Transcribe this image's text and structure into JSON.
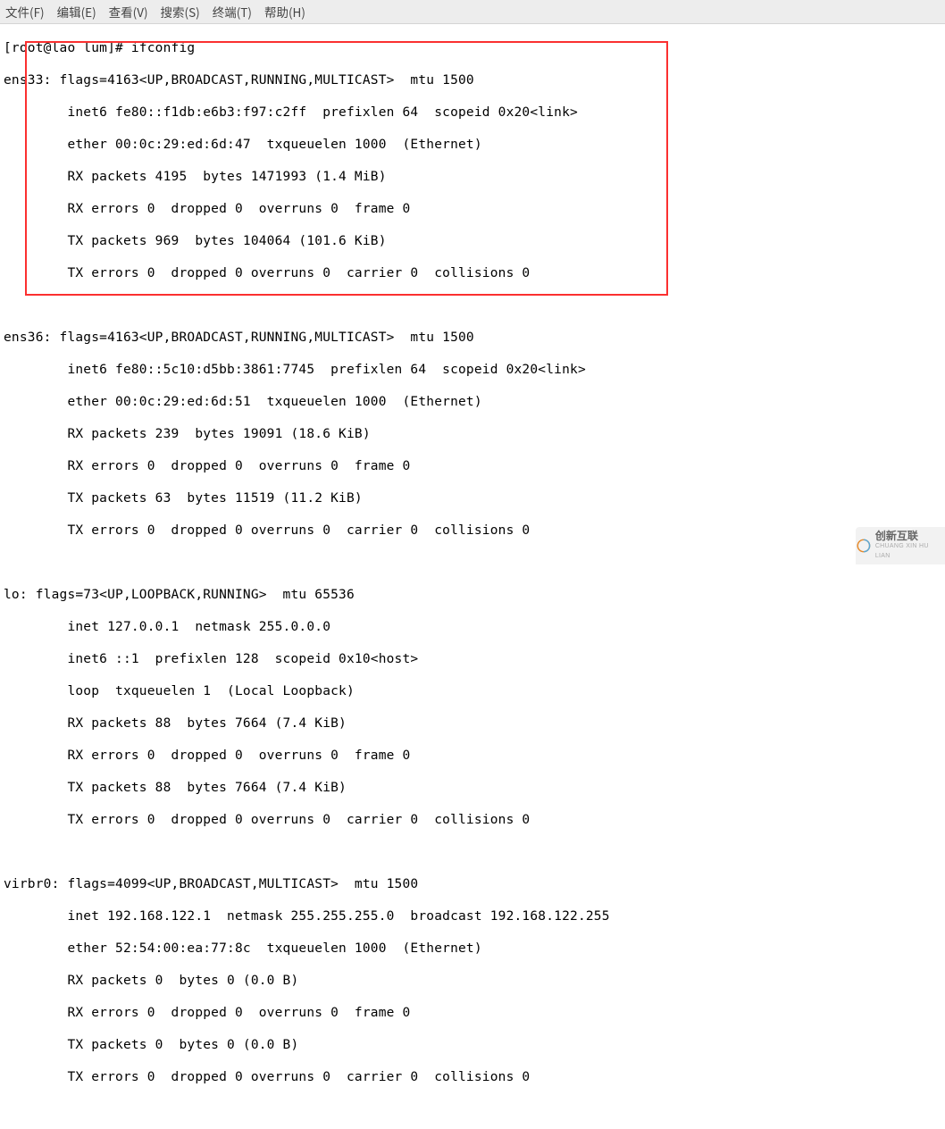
{
  "menu": {
    "file": "文件(F)",
    "edit": "编辑(E)",
    "view": "查看(V)",
    "search": "搜索(S)",
    "terminal": "终端(T)",
    "help": "帮助(H)"
  },
  "prompt": "[root@lao lum]# ifconfig",
  "if1": {
    "l1": "ens33: flags=4163<UP,BROADCAST,RUNNING,MULTICAST>  mtu 1500",
    "l2": "        inet6 fe80::f1db:e6b3:f97:c2ff  prefixlen 64  scopeid 0x20<link>",
    "l3": "        ether 00:0c:29:ed:6d:47  txqueuelen 1000  (Ethernet)",
    "l4": "        RX packets 4195  bytes 1471993 (1.4 MiB)",
    "l5": "        RX errors 0  dropped 0  overruns 0  frame 0",
    "l6": "        TX packets 969  bytes 104064 (101.6 KiB)",
    "l7": "        TX errors 0  dropped 0 overruns 0  carrier 0  collisions 0"
  },
  "if2": {
    "l1": "ens36: flags=4163<UP,BROADCAST,RUNNING,MULTICAST>  mtu 1500",
    "l2": "        inet6 fe80::5c10:d5bb:3861:7745  prefixlen 64  scopeid 0x20<link>",
    "l3": "        ether 00:0c:29:ed:6d:51  txqueuelen 1000  (Ethernet)",
    "l4": "        RX packets 239  bytes 19091 (18.6 KiB)",
    "l5": "        RX errors 0  dropped 0  overruns 0  frame 0",
    "l6": "        TX packets 63  bytes 11519 (11.2 KiB)",
    "l7": "        TX errors 0  dropped 0 overruns 0  carrier 0  collisions 0"
  },
  "if3": {
    "l1": "lo: flags=73<UP,LOOPBACK,RUNNING>  mtu 65536",
    "l2": "        inet 127.0.0.1  netmask 255.0.0.0",
    "l3": "        inet6 ::1  prefixlen 128  scopeid 0x10<host>",
    "l4": "        loop  txqueuelen 1  (Local Loopback)",
    "l5": "        RX packets 88  bytes 7664 (7.4 KiB)",
    "l6": "        RX errors 0  dropped 0  overruns 0  frame 0",
    "l7": "        TX packets 88  bytes 7664 (7.4 KiB)",
    "l8": "        TX errors 0  dropped 0 overruns 0  carrier 0  collisions 0"
  },
  "if4": {
    "l1": "virbr0: flags=4099<UP,BROADCAST,MULTICAST>  mtu 1500",
    "l2": "        inet 192.168.122.1  netmask 255.255.255.0  broadcast 192.168.122.255",
    "l3": "        ether 52:54:00:ea:77:8c  txqueuelen 1000  (Ethernet)",
    "l4": "        RX packets 0  bytes 0 (0.0 B)",
    "l5": "        RX errors 0  dropped 0  overruns 0  frame 0",
    "l6": "        TX packets 0  bytes 0 (0.0 B)",
    "l7": "        TX errors 0  dropped 0 overruns 0  carrier 0  collisions 0"
  },
  "watermark": {
    "zh": "创新互联",
    "en": "CHUANG XIN HU LIAN"
  }
}
